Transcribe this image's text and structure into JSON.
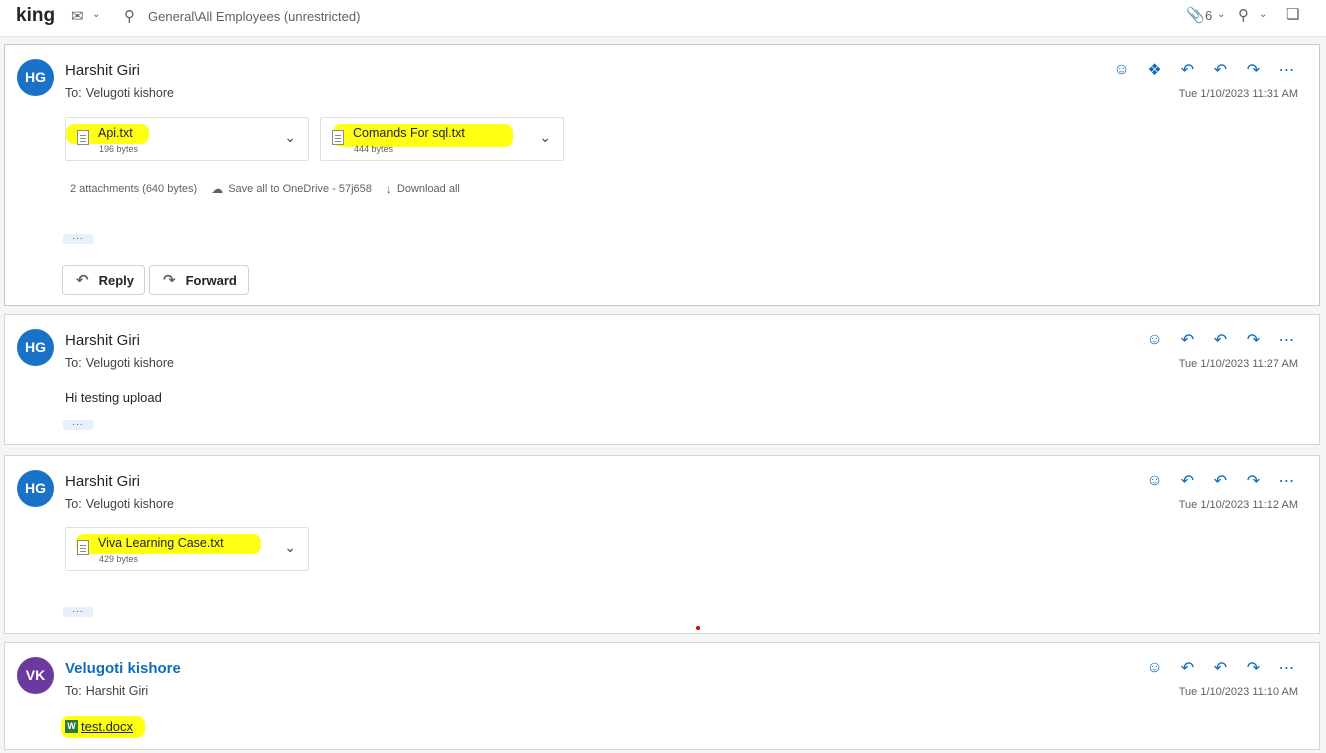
{
  "header": {
    "subject": "king",
    "channel": "General\\All Employees (unrestricted)",
    "attachment_count": "6"
  },
  "colors": {
    "accent": "#0f6cbd",
    "avatar_hg": "#1a72c8",
    "avatar_vk": "#6b3aa0",
    "highlight": "#ffff00"
  },
  "messages": [
    {
      "initials": "HG",
      "sender": "Harshit Giri",
      "to_label": "To:",
      "to": "Velugoti kishore",
      "time": "Tue 1/10/2023 11:31 AM",
      "attachments": [
        {
          "name": "Api.txt",
          "size": "196 bytes"
        },
        {
          "name": "Comands For sql.txt",
          "size": "444 bytes"
        }
      ],
      "attachments_summary": "2 attachments (640 bytes)",
      "save_all": "Save all to OneDrive - 57j658",
      "download_all": "Download all",
      "reply": "Reply",
      "forward": "Forward"
    },
    {
      "initials": "HG",
      "sender": "Harshit Giri",
      "to_label": "To:",
      "to": "Velugoti kishore",
      "time": "Tue 1/10/2023 11:27 AM",
      "body": "Hi testing upload"
    },
    {
      "initials": "HG",
      "sender": "Harshit Giri",
      "to_label": "To:",
      "to": "Velugoti kishore",
      "time": "Tue 1/10/2023 11:12 AM",
      "attachments": [
        {
          "name": "Viva Learning Case.txt",
          "size": "429 bytes"
        }
      ]
    },
    {
      "initials": "VK",
      "sender": "Velugoti kishore",
      "to_label": "To:",
      "to": "Harshit Giri",
      "time": "Tue 1/10/2023 11:10 AM",
      "link": "test.docx"
    }
  ]
}
